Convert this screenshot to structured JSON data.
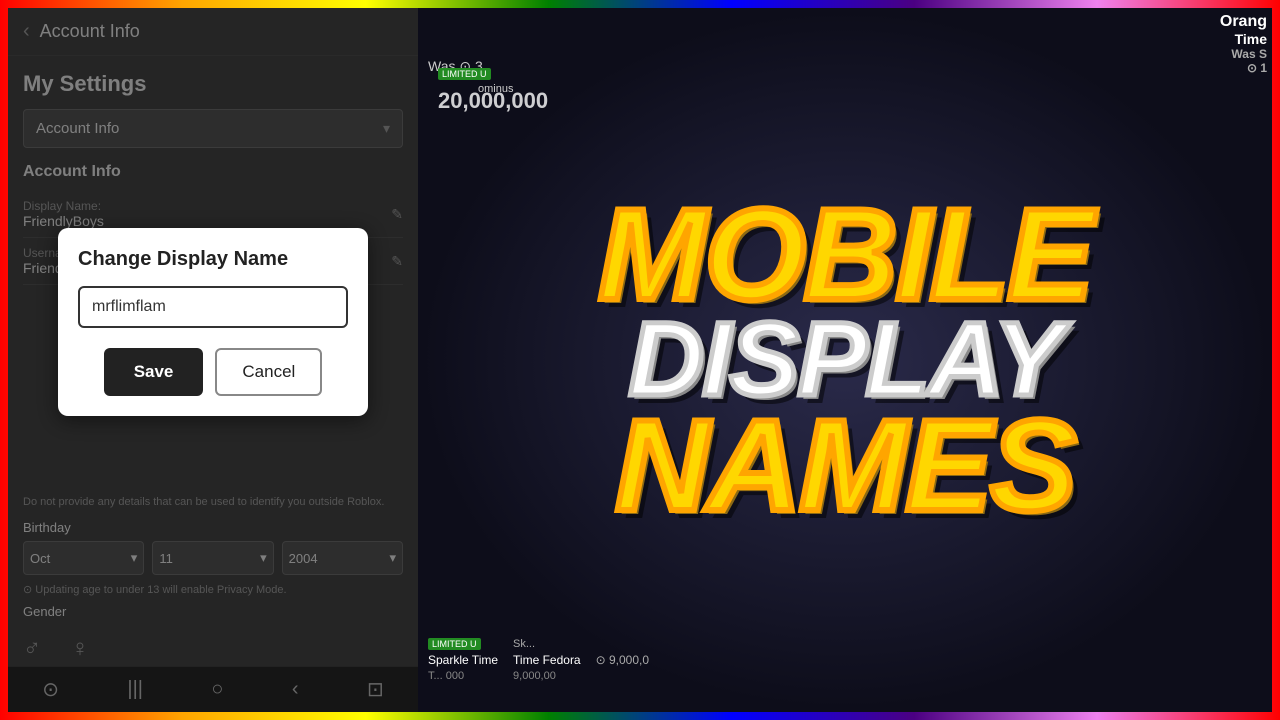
{
  "rainbow": {
    "visible": true
  },
  "phone": {
    "header": {
      "back_label": "‹",
      "title": "Account Info"
    },
    "settings": {
      "title": "My Settings",
      "dropdown": {
        "label": "Account Info",
        "arrow": "▾"
      }
    },
    "account_info": {
      "section_title": "Account Info",
      "display_name_label": "Display Name:",
      "display_name_value": "FriendlyBoys",
      "username_label": "Username:",
      "username_value": "FriendlyBoys"
    },
    "modal": {
      "title": "Change Display Name",
      "input_value": "mrflimflam",
      "save_label": "Save",
      "cancel_label": "Cancel"
    },
    "privacy_note": "Do not provide any details that can be used to identify you outside Roblox.",
    "birthday": {
      "label": "Birthday",
      "month": "Oct",
      "day": "11",
      "year": "2004",
      "month_arrow": "▾",
      "day_arrow": "▾",
      "year_arrow": "▾"
    },
    "age_note": "⊙  Updating age to under 13 will enable Privacy Mode.",
    "gender": {
      "label": "Gender"
    },
    "nav": {
      "icons": [
        "⊙",
        "|||",
        "○",
        "‹",
        "⊡"
      ]
    }
  },
  "overlay": {
    "title_line1": "MOBILE",
    "title_line2": "DISPLAY",
    "title_line3": "NAMES",
    "corner_top": "Orang",
    "corner_sub": "Time",
    "corner_sub2": "Was S",
    "corner_num": "⊙ 1",
    "sparkle_badge": "LIMITED U",
    "sparkle_name": "Sparkle Time",
    "sparkle_name2": "Sparkle",
    "time_fedora": "Time Fedora",
    "price1": "9,000,0",
    "price2": "9,000,00"
  }
}
